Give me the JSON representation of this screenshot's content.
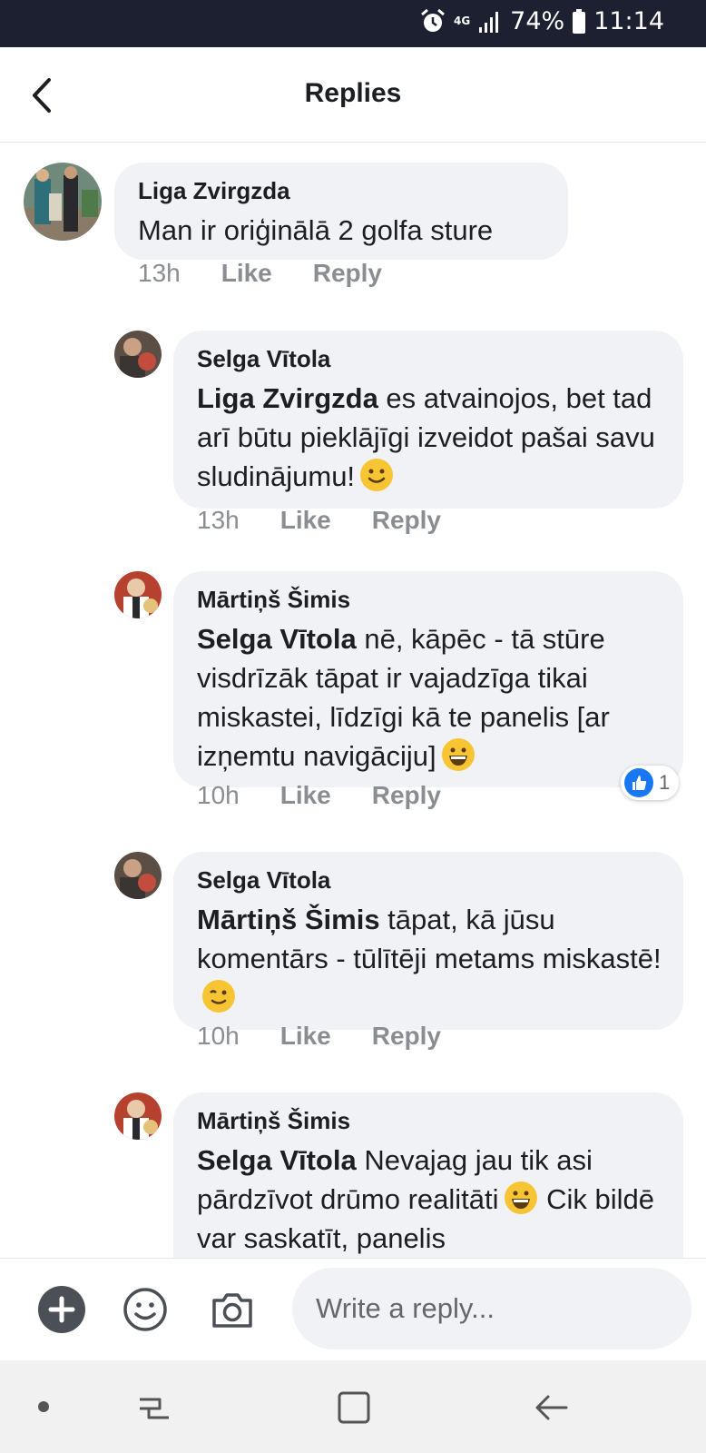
{
  "status_bar": {
    "network": "4G",
    "battery": "74%",
    "time": "11:14"
  },
  "header": {
    "title": "Replies"
  },
  "comments": [
    {
      "author": "Liga Zvirgzda",
      "mention": "",
      "text": "Man ir oriģinālā 2 golfa sture",
      "time": "13h",
      "like_label": "Like",
      "reply_label": "Reply"
    },
    {
      "author": "Selga Vītola",
      "mention": "Liga Zvirgzda",
      "text": " es atvainojos, bet tad arī būtu pieklājīgi izveidot pašai savu sludinājumu!",
      "time": "13h",
      "like_label": "Like",
      "reply_label": "Reply"
    },
    {
      "author": "Mārtiņš Šimis",
      "mention": "Selga Vītola",
      "text": " nē, kāpēc - tā stūre visdrīzāk tāpat ir vajadzīga tikai miskastei, līdzīgi kā te panelis [ar izņemtu navigāciju]",
      "time": "10h",
      "like_label": "Like",
      "reply_label": "Reply",
      "reaction_count": "1"
    },
    {
      "author": "Selga Vītola",
      "mention": "Mārtiņš Šimis",
      "text": " tāpat, kā jūsu komentārs - tūlītēji metams miskastē!",
      "time": "10h",
      "like_label": "Like",
      "reply_label": "Reply"
    },
    {
      "author": "Mārtiņš Šimis",
      "mention": "Selga Vītola",
      "text": " Nevajag jau tik asi pārdzīvot drūmo realitāti",
      "text_after": " Cik bildē var saskatīt, panelis"
    }
  ],
  "composer": {
    "placeholder": "Write a reply..."
  },
  "colors": {
    "accent": "#1877f2",
    "bubble": "#f0f2f5",
    "status_bar": "#1c2030",
    "muted": "#8a8d91"
  },
  "icons": [
    "alarm-icon",
    "signal-icon",
    "battery-icon",
    "back-arrow-icon",
    "like-reaction-icon",
    "plus-icon",
    "emoji-icon",
    "camera-icon",
    "nav-recent-icon",
    "nav-home-icon",
    "nav-back-icon"
  ]
}
